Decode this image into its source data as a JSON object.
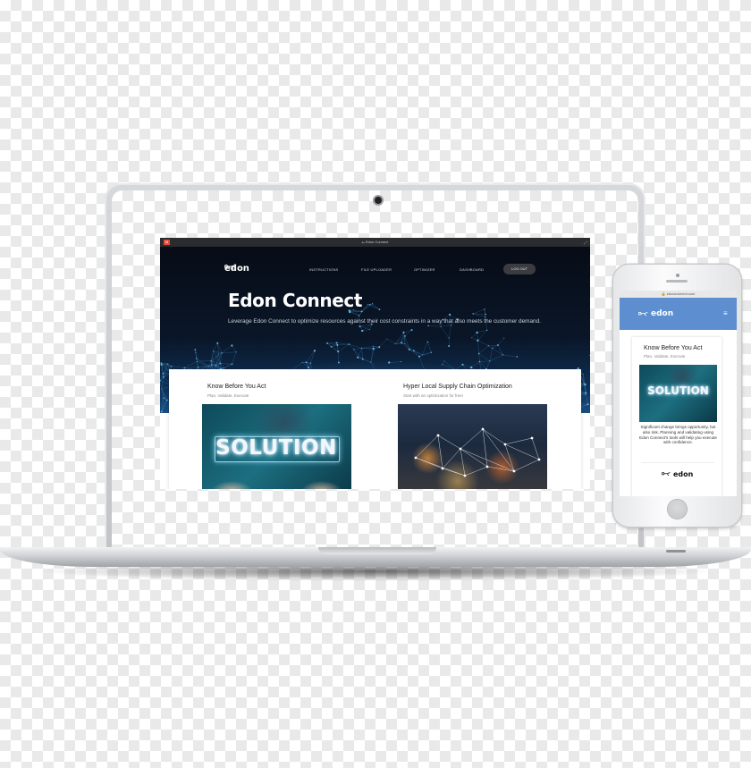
{
  "laptop_app": {
    "window_title": "Edon Connect",
    "brand": "edon",
    "nav": [
      "INSTRUCTIONS",
      "FILE UPLOADER",
      "OPTIMIZER",
      "DASHBOARD"
    ],
    "logout_label": "LOG OUT",
    "hero_title": "Edon Connect",
    "hero_subtitle": "Leverage Edon Connect to optimize resources against their cost constraints in a way that also meets the customer demand.",
    "cards": [
      {
        "title": "Know Before You Act",
        "subtitle": "Plan, Validate, Execute",
        "image_text": "SOLUTION"
      },
      {
        "title": "Hyper Local Supply Chain Optimization",
        "subtitle": "Start with an optimization for free!"
      }
    ]
  },
  "phone_app": {
    "url": "edonconnect.com",
    "brand": "edon",
    "card_title": "Know Before You Act",
    "card_subtitle": "Plan, Validate, Execute",
    "image_text": "SOLUTION",
    "body_text": "Significant change brings opportunity, but also risk. Planning and validating using Edon Connect's tools will help you execute with confidence.",
    "footer_brand": "edon"
  },
  "colors": {
    "hero_dark": "#0a1628",
    "phone_header": "#5d8ecf",
    "logout_bg": "#3a3c40"
  },
  "icons": [
    "edon-logo-icon",
    "gmail-icon",
    "hamburger-menu-icon",
    "camera-icon",
    "home-button"
  ]
}
